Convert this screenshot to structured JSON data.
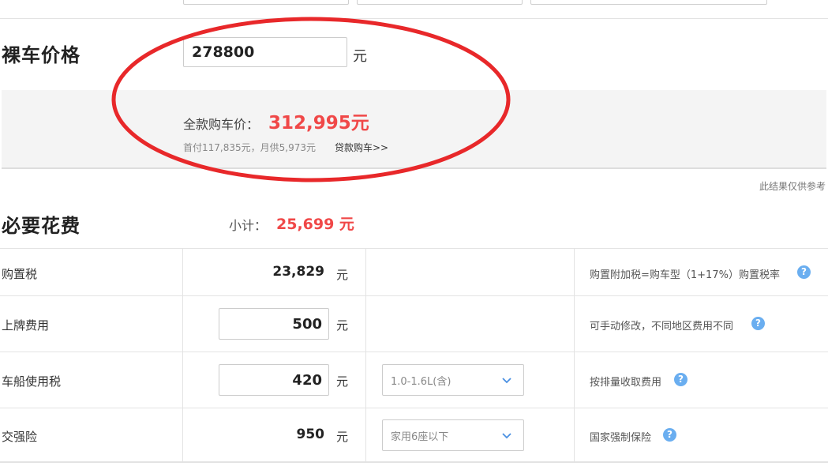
{
  "base_price": {
    "title": "裸车价格",
    "value": "278800",
    "unit": "元"
  },
  "total": {
    "label": "全款购车价：",
    "value": "312,995元",
    "loan_summary": "首付117,835元，月供5,973元",
    "loan_link": "贷款购车>>"
  },
  "note": "此结果仅供参考",
  "required": {
    "title": "必要花费",
    "subtotal_label": "小计：",
    "subtotal_value": "25,699 元",
    "rows": [
      {
        "label": "购置税",
        "value": "23,829",
        "unit": "元",
        "editable": false,
        "option": "",
        "desc": "购置附加税=购车型（1+17%）购置税率"
      },
      {
        "label": "上牌费用",
        "value": "500",
        "unit": "元",
        "editable": true,
        "option": "",
        "desc": "可手动修改，不同地区费用不同"
      },
      {
        "label": "车船使用税",
        "value": "420",
        "unit": "元",
        "editable": true,
        "option": "1.0-1.6L(含)",
        "desc": "按排量收取费用"
      },
      {
        "label": "交强险",
        "value": "950",
        "unit": "元",
        "editable": false,
        "option": "家用6座以下",
        "desc": "国家强制保险"
      }
    ]
  },
  "icons": {
    "help": "help-icon",
    "dropdown": "chevron-down-icon"
  },
  "colors": {
    "accent_red": "#f04848",
    "help_blue": "#6aaef0",
    "highlight_circle": "#e8282a"
  }
}
